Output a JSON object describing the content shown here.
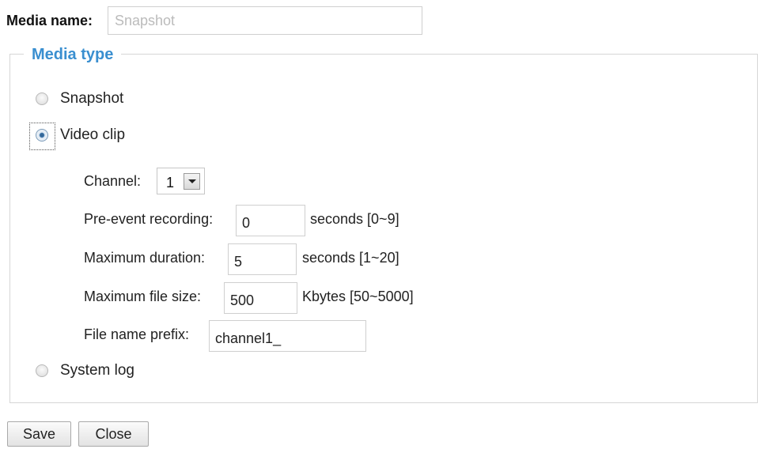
{
  "media_name": {
    "label": "Media name:",
    "placeholder": "Snapshot",
    "value": ""
  },
  "media_type": {
    "legend": "Media type",
    "options": [
      {
        "label": "Snapshot",
        "checked": false
      },
      {
        "label": "Video clip",
        "checked": true
      },
      {
        "label": "System log",
        "checked": false
      }
    ]
  },
  "video_clip": {
    "channel": {
      "label": "Channel:",
      "value": "1"
    },
    "pre_event": {
      "label": "Pre-event recording:",
      "value": "0",
      "hint": "seconds [0~9]"
    },
    "max_duration": {
      "label": "Maximum duration:",
      "value": "5",
      "hint": "seconds [1~20]"
    },
    "max_file_size": {
      "label": "Maximum file size:",
      "value": "500",
      "hint": "Kbytes [50~5000]"
    },
    "file_prefix": {
      "label": "File name prefix:",
      "value": "channel1_"
    }
  },
  "buttons": {
    "save": "Save",
    "close": "Close"
  }
}
